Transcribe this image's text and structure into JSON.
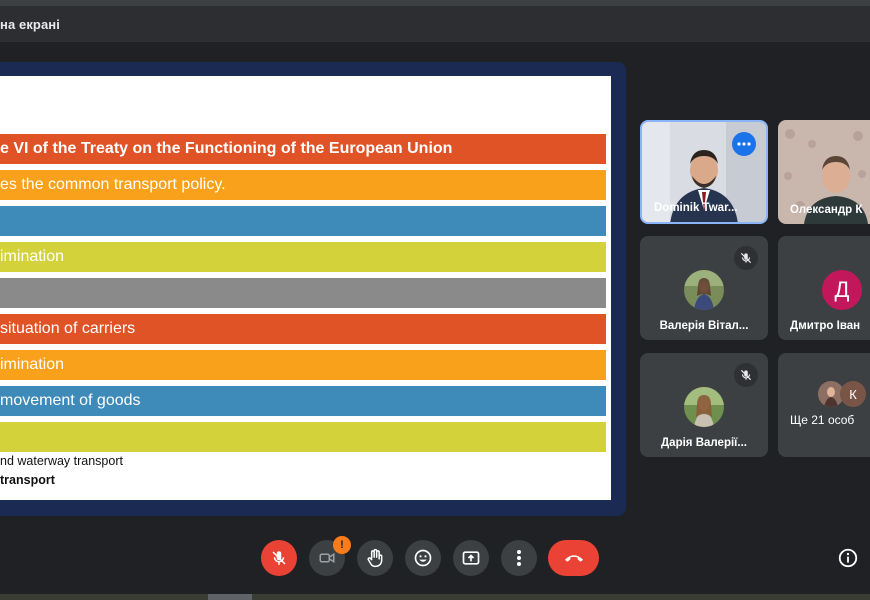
{
  "window": {
    "title": "на екрані"
  },
  "slide": {
    "bars": [
      {
        "text": "e VI of the Treaty on the Functioning of the European Union",
        "color": "#e05327",
        "bold": true
      },
      {
        "text": "es the common transport policy.",
        "color": "#f9a11b",
        "bold": false
      },
      {
        "text": "",
        "color": "#3e8ab8",
        "bold": false
      },
      {
        "text": "imination",
        "color": "#d4d23b",
        "bold": false
      },
      {
        "text": "",
        "color": "#8a8a8a",
        "bold": false
      },
      {
        "text": "situation of carriers",
        "color": "#e05327",
        "bold": false
      },
      {
        "text": "imination",
        "color": "#f9a11b",
        "bold": false
      },
      {
        "text": "movement of goods",
        "color": "#3e8ab8",
        "bold": false
      },
      {
        "text": "",
        "color": "#d4d23b",
        "bold": false
      }
    ],
    "line1": "nd waterway transport",
    "line2": "transport"
  },
  "participants": [
    {
      "name": "Dominik Twar...",
      "type": "video",
      "active": true
    },
    {
      "name": "Олександр К",
      "type": "video",
      "active": false
    },
    {
      "name": "Валерія Вітал...",
      "type": "photo",
      "muted": true
    },
    {
      "name": "Дмитро Іван",
      "type": "letter",
      "letter": "Д",
      "color": "#c2185b"
    },
    {
      "name": "Дарія Валерії...",
      "type": "photo",
      "muted": true
    },
    {
      "name": "Ще 21 особ",
      "type": "group",
      "letter": "К",
      "color": "#795548"
    }
  ],
  "controls": {
    "camera_badge": "!"
  },
  "colors": {
    "background": "#202124",
    "tile": "#3c4043",
    "accent_blue": "#8ab4f8",
    "end_call": "#ea4335",
    "badge": "#fa7b17"
  }
}
